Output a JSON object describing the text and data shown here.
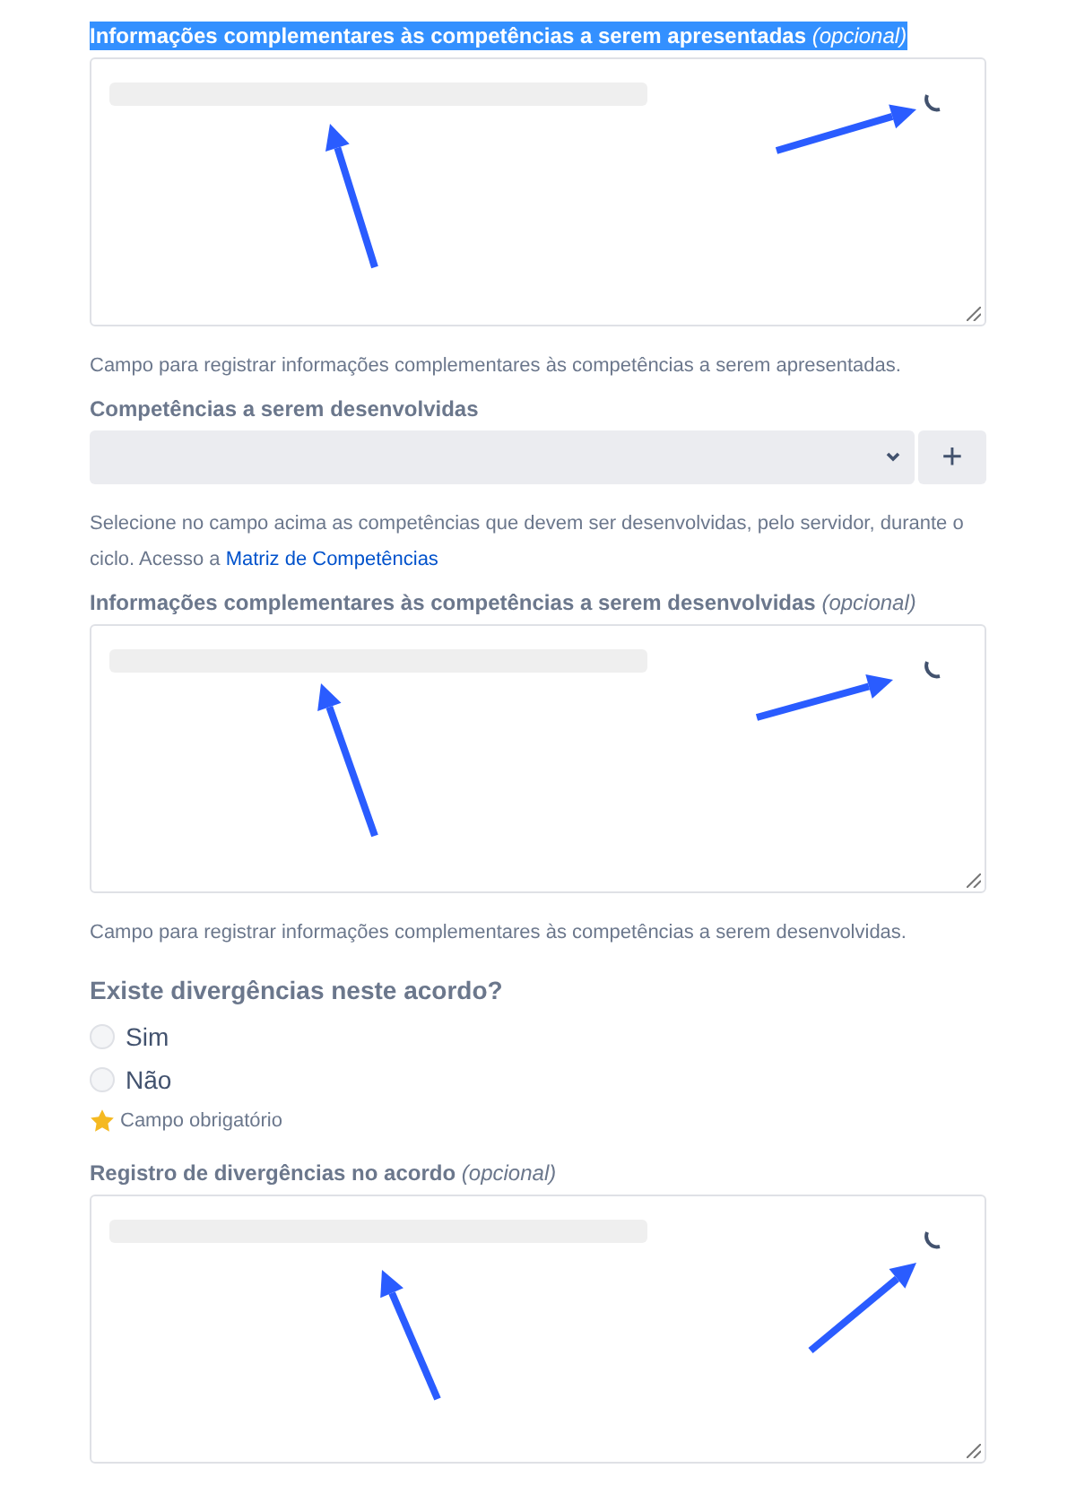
{
  "sections": [
    {
      "kind": "editor",
      "label": "Informações complementares às competências a serem apresentadas",
      "optional": "(opcional)",
      "highlighted": true,
      "loading": true,
      "help": "Campo para registrar informações complementares às competências a serem apresentadas."
    },
    {
      "kind": "select",
      "label": "Competências a serem desenvolvidas",
      "add_button": "+",
      "help": "Selecione no campo acima as competências que devem ser desenvolvidas, pelo servidor, durante o ciclo. Acesso a ",
      "link": "Matriz de Competências"
    },
    {
      "kind": "editor",
      "label": "Informações complementares às competências a serem desenvolvidas",
      "optional": "(opcional)",
      "highlighted": false,
      "loading": true,
      "help": "Campo para registrar informações complementares às competências a serem desenvolvidas."
    },
    {
      "kind": "radio",
      "label": "Existe divergências neste acordo?",
      "options": [
        {
          "label": "Sim",
          "selected": false
        },
        {
          "label": "Não",
          "selected": false
        }
      ],
      "required_note": "Campo obrigatório"
    },
    {
      "kind": "editor",
      "label": "Registro de divergências no acordo",
      "optional": "(opcional)",
      "highlighted": false,
      "loading": true
    }
  ]
}
